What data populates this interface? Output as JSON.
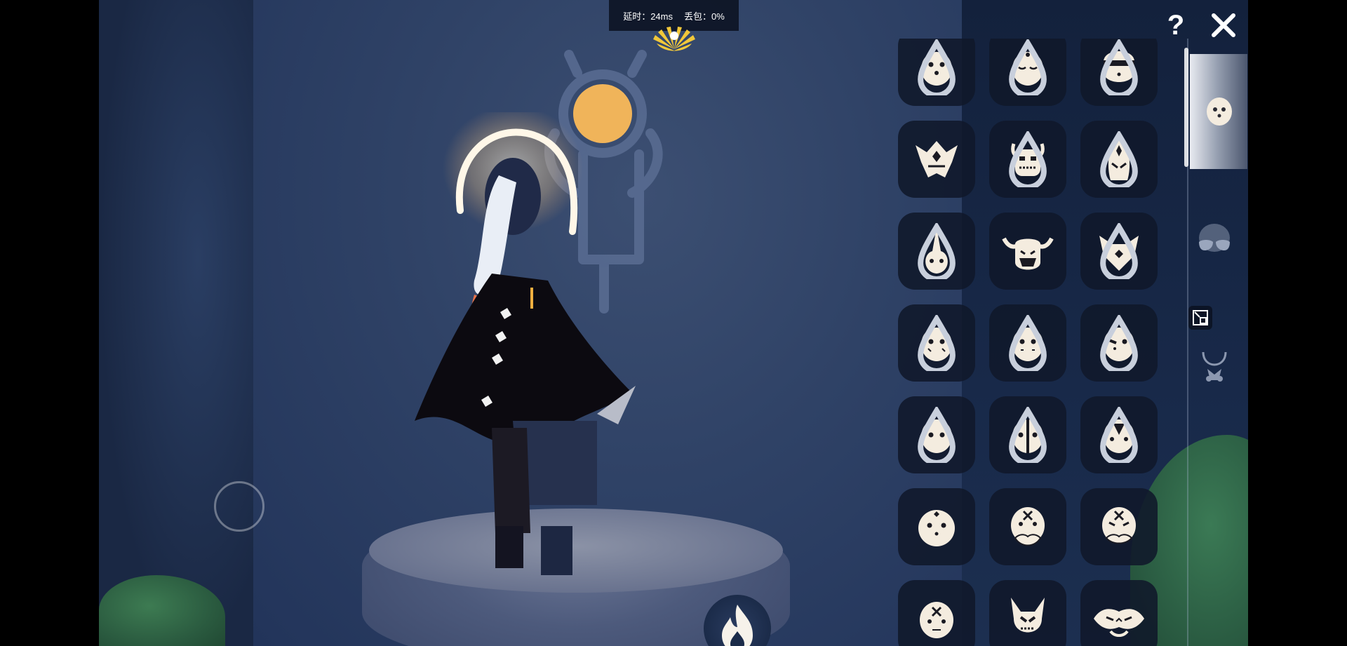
{
  "stats": {
    "latency": "延时：24ms",
    "packet_loss": "丢包：0%"
  },
  "top_buttons": {
    "help": "?"
  },
  "outfit_grid": {
    "items": [
      {
        "icon": "mask-three-dots",
        "locked": true
      },
      {
        "icon": "mask-sleepy",
        "locked": true
      },
      {
        "icon": "mask-headband",
        "locked": true
      },
      {
        "icon": "mask-crowned-spiked",
        "locked": false
      },
      {
        "icon": "mask-horned-skull",
        "locked": true
      },
      {
        "icon": "mask-tall-tribal",
        "locked": true
      },
      {
        "icon": "mask-horn-point",
        "locked": true
      },
      {
        "icon": "mask-ox-fanged",
        "locked": false
      },
      {
        "icon": "mask-fox",
        "locked": true
      },
      {
        "icon": "mask-dots-cheeks",
        "locked": true
      },
      {
        "icon": "mask-dots-cheeks-2",
        "locked": true
      },
      {
        "icon": "mask-dots-tilted",
        "locked": true
      },
      {
        "icon": "mask-two-dots",
        "locked": true
      },
      {
        "icon": "mask-split-line",
        "locked": true
      },
      {
        "icon": "mask-v-mark",
        "locked": true
      },
      {
        "icon": "mask-diamond-dots",
        "locked": false
      },
      {
        "icon": "mask-mustache-x",
        "locked": false
      },
      {
        "icon": "mask-mustache-x-2",
        "locked": false
      },
      {
        "icon": "mask-cross-mark",
        "locked": false
      },
      {
        "icon": "mask-bat-eared",
        "locked": false
      },
      {
        "icon": "mask-wide-tribal",
        "locked": false
      }
    ]
  },
  "category_tabs": [
    {
      "icon": "mask-tab-icon",
      "active": true
    },
    {
      "icon": "sunglasses-icon",
      "active": false
    },
    {
      "icon": "necklace-icon",
      "active": false
    }
  ],
  "colors": {
    "panel_bg": "#10182a",
    "icon_fill": "#f4ecdf",
    "halo_glow": "#ffd9a0",
    "mural_sun": "#f0b45a"
  }
}
